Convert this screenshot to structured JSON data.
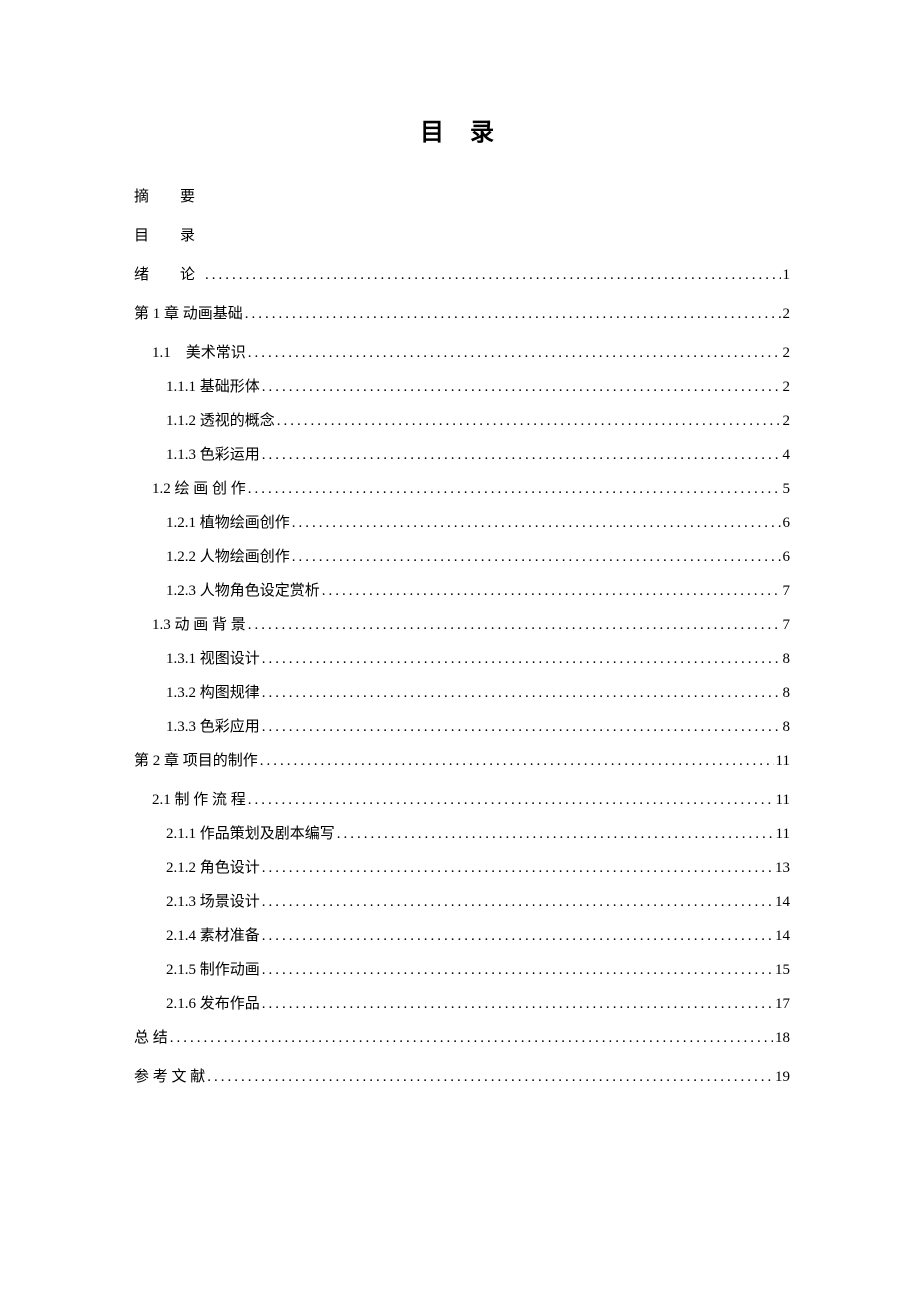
{
  "title": "目 录",
  "entries": [
    {
      "level": 0,
      "label": "摘　要",
      "page": "",
      "dots": false,
      "spaced": true
    },
    {
      "level": 0,
      "label": "目　录",
      "page": "",
      "dots": false,
      "spaced": true
    },
    {
      "level": 0,
      "label": "绪　论",
      "page": "1",
      "dots": true,
      "spaced": true
    },
    {
      "level": 0,
      "label": "第 1 章  动画基础",
      "page": "2",
      "dots": true
    },
    {
      "level": 1,
      "label": "1.1　美术常识",
      "page": "2",
      "dots": true
    },
    {
      "level": 2,
      "label": "1.1.1 基础形体",
      "page": "2",
      "dots": true
    },
    {
      "level": 2,
      "label": "1.1.2 透视的概念",
      "page": "2",
      "dots": true
    },
    {
      "level": 2,
      "label": "1.1.3 色彩运用",
      "page": "4",
      "dots": true
    },
    {
      "level": 1,
      "label": "1.2 绘 画 创 作",
      "page": "5",
      "dots": true
    },
    {
      "level": 2,
      "label": "1.2.1 植物绘画创作",
      "page": "6",
      "dots": true
    },
    {
      "level": 2,
      "label": "1.2.2 人物绘画创作",
      "page": "6",
      "dots": true
    },
    {
      "level": 2,
      "label": "1.2.3 人物角色设定赏析",
      "page": "7",
      "dots": true
    },
    {
      "level": 1,
      "label": "1.3 动 画 背 景",
      "page": "7",
      "dots": true
    },
    {
      "level": 2,
      "label": "1.3.1 视图设计",
      "page": "8",
      "dots": true
    },
    {
      "level": 2,
      "label": "1.3.2 构图规律",
      "page": "8",
      "dots": true
    },
    {
      "level": 2,
      "label": "1.3.3 色彩应用",
      "page": "8",
      "dots": true
    },
    {
      "level": 0,
      "label": "第 2 章  项目的制作",
      "page": "11",
      "dots": true
    },
    {
      "level": 1,
      "label": "2.1 制 作 流 程",
      "page": "11",
      "dots": true
    },
    {
      "level": 2,
      "label": "2.1.1 作品策划及剧本编写",
      "page": "11",
      "dots": true
    },
    {
      "level": 2,
      "label": "2.1.2 角色设计",
      "page": "13",
      "dots": true
    },
    {
      "level": 2,
      "label": "2.1.3 场景设计",
      "page": "14",
      "dots": true
    },
    {
      "level": 2,
      "label": "2.1.4 素材准备",
      "page": "14",
      "dots": true
    },
    {
      "level": 2,
      "label": "2.1.5 制作动画",
      "page": "15",
      "dots": true
    },
    {
      "level": 2,
      "label": "2.1.6 发布作品",
      "page": "17",
      "dots": true
    },
    {
      "level": 0,
      "label": "总 结",
      "page": "18",
      "dots": true
    },
    {
      "level": 0,
      "label": "参 考 文 献",
      "page": "19",
      "dots": true
    }
  ]
}
